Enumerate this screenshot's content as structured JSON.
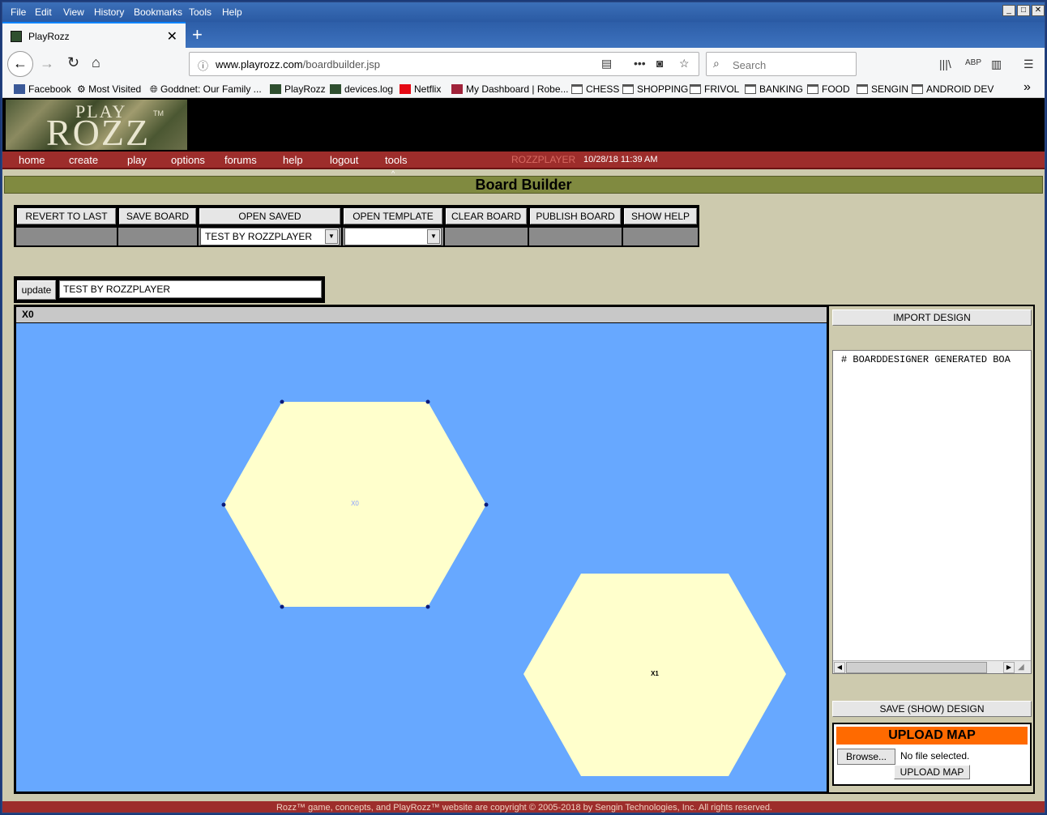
{
  "browser": {
    "menu": [
      "File",
      "Edit",
      "View",
      "History",
      "Bookmarks",
      "Tools",
      "Help"
    ],
    "tab_title": "PlayRozz",
    "url_host": "www.playrozz.com",
    "url_path": "/boardbuilder.jsp",
    "search_placeholder": "Search",
    "bookmarks": [
      "Facebook",
      "Most Visited",
      "Goddnet: Our Family ...",
      "PlayRozz",
      "devices.log",
      "Netflix",
      "My Dashboard | Robe...",
      "CHESS",
      "SHOPPING",
      "FRIVOL",
      "BANKING",
      "FOOD",
      "SENGIN",
      "ANDROID DEV"
    ]
  },
  "site": {
    "logo_top": "PLAY",
    "logo_main": "ROZZ",
    "logo_tm": "TM",
    "nav": [
      "home",
      "create",
      "play",
      "options",
      "forums",
      "help",
      "logout",
      "tools"
    ],
    "username": "ROZZPLAYER",
    "timestamp": "10/28/18 11:39 AM",
    "page_title": "Board Builder"
  },
  "toolbar": {
    "buttons": [
      "REVERT TO LAST",
      "SAVE BOARD",
      "OPEN SAVED",
      "OPEN TEMPLATE",
      "CLEAR BOARD",
      "PUBLISH BOARD",
      "SHOW HELP"
    ],
    "open_saved_value": "TEST BY ROZZPLAYER",
    "open_template_value": ""
  },
  "update": {
    "button": "update",
    "name_value": "TEST BY ROZZPLAYER"
  },
  "board": {
    "header": "X0",
    "hex_labels": [
      "X0",
      "X1"
    ],
    "colors": {
      "water": "#67a8ff",
      "hex": "#ffffcc"
    }
  },
  "side": {
    "import_button": "IMPORT DESIGN",
    "design_text": "# BOARDDESIGNER GENERATED BOA",
    "save_show_button": "SAVE (SHOW) DESIGN",
    "upload_header": "UPLOAD MAP",
    "browse_button": "Browse...",
    "no_file": "No file selected.",
    "upload_button": "UPLOAD MAP"
  },
  "footer": "Rozz™ game, concepts, and PlayRozz™ website are copyright © 2005-2018 by Sengin Technologies, Inc. All rights reserved."
}
